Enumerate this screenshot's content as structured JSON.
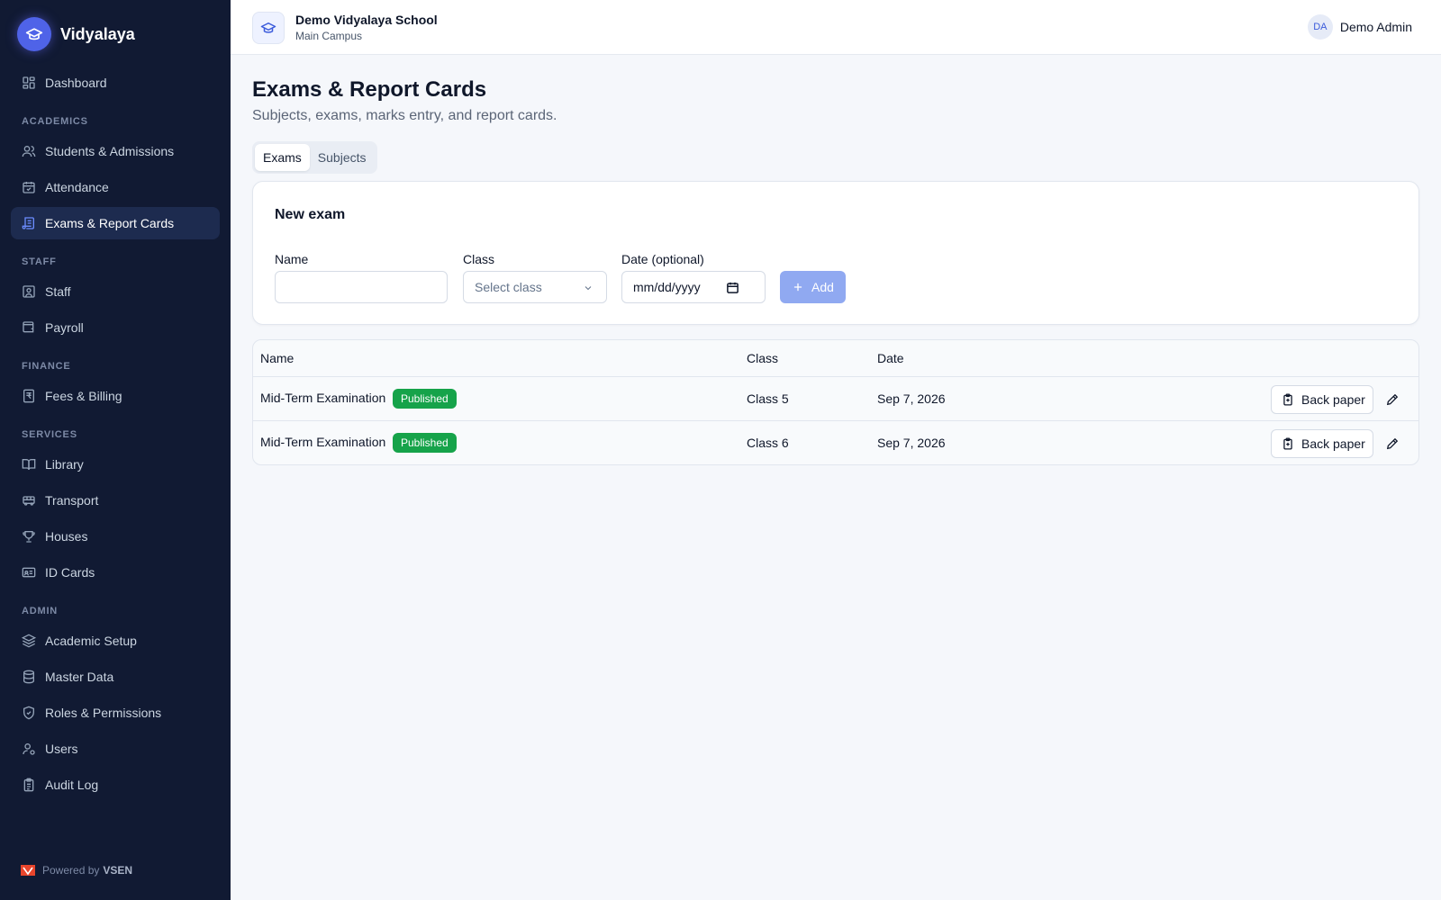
{
  "app": {
    "brand_name": "Vidyalaya",
    "brand_icon": "graduation-cap-icon"
  },
  "sidebar": {
    "items": [
      {
        "type": "item",
        "label": "Dashboard",
        "icon": "dashboard-icon",
        "active": false
      },
      {
        "type": "section",
        "label": "ACADEMICS"
      },
      {
        "type": "item",
        "label": "Students & Admissions",
        "icon": "users-icon",
        "active": false
      },
      {
        "type": "item",
        "label": "Attendance",
        "icon": "calendar-check-icon",
        "active": false
      },
      {
        "type": "item",
        "label": "Exams & Report Cards",
        "icon": "scroll-icon",
        "active": true
      },
      {
        "type": "section",
        "label": "STAFF"
      },
      {
        "type": "item",
        "label": "Staff",
        "icon": "contact-icon",
        "active": false
      },
      {
        "type": "item",
        "label": "Payroll",
        "icon": "wallet-icon",
        "active": false
      },
      {
        "type": "section",
        "label": "FINANCE"
      },
      {
        "type": "item",
        "label": "Fees & Billing",
        "icon": "rupee-receipt-icon",
        "active": false
      },
      {
        "type": "section",
        "label": "SERVICES"
      },
      {
        "type": "item",
        "label": "Library",
        "icon": "book-icon",
        "active": false
      },
      {
        "type": "item",
        "label": "Transport",
        "icon": "bus-icon",
        "active": false
      },
      {
        "type": "item",
        "label": "Houses",
        "icon": "trophy-icon",
        "active": false
      },
      {
        "type": "item",
        "label": "ID Cards",
        "icon": "id-card-icon",
        "active": false
      },
      {
        "type": "section",
        "label": "ADMIN"
      },
      {
        "type": "item",
        "label": "Academic Setup",
        "icon": "layers-icon",
        "active": false
      },
      {
        "type": "item",
        "label": "Master Data",
        "icon": "database-icon",
        "active": false
      },
      {
        "type": "item",
        "label": "Roles & Permissions",
        "icon": "shield-icon",
        "active": false
      },
      {
        "type": "item",
        "label": "Users",
        "icon": "user-gear-icon",
        "active": false
      },
      {
        "type": "item",
        "label": "Audit Log",
        "icon": "clipboard-list-icon",
        "active": false
      }
    ],
    "footer": {
      "prefix": "Powered by",
      "brand": "VSEN"
    }
  },
  "topbar": {
    "school_name": "Demo Vidyalaya School",
    "campus": "Main Campus",
    "user_initials": "DA",
    "user_name": "Demo Admin"
  },
  "page": {
    "title": "Exams & Report Cards",
    "subtitle": "Subjects, exams, marks entry, and report cards.",
    "tabs": [
      {
        "label": "Exams",
        "active": true
      },
      {
        "label": "Subjects",
        "active": false
      }
    ]
  },
  "new_exam": {
    "title": "New exam",
    "name_label": "Name",
    "name_value": "",
    "class_label": "Class",
    "class_placeholder": "Select class",
    "date_label": "Date (optional)",
    "date_placeholder": "mm/dd/yyyy",
    "add_label": "Add"
  },
  "exams_table": {
    "headers": {
      "name": "Name",
      "class": "Class",
      "date": "Date"
    },
    "rows": [
      {
        "name": "Mid-Term Examination",
        "status": "Published",
        "class": "Class 5",
        "date": "Sep 7, 2026",
        "action": "Back paper"
      },
      {
        "name": "Mid-Term Examination",
        "status": "Published",
        "class": "Class 6",
        "date": "Sep 7, 2026",
        "action": "Back paper"
      }
    ]
  },
  "colors": {
    "sidebar_bg": "#111a33",
    "accent": "#4f63e8",
    "published_badge": "#16a34a",
    "add_button": "#90a9f1"
  }
}
